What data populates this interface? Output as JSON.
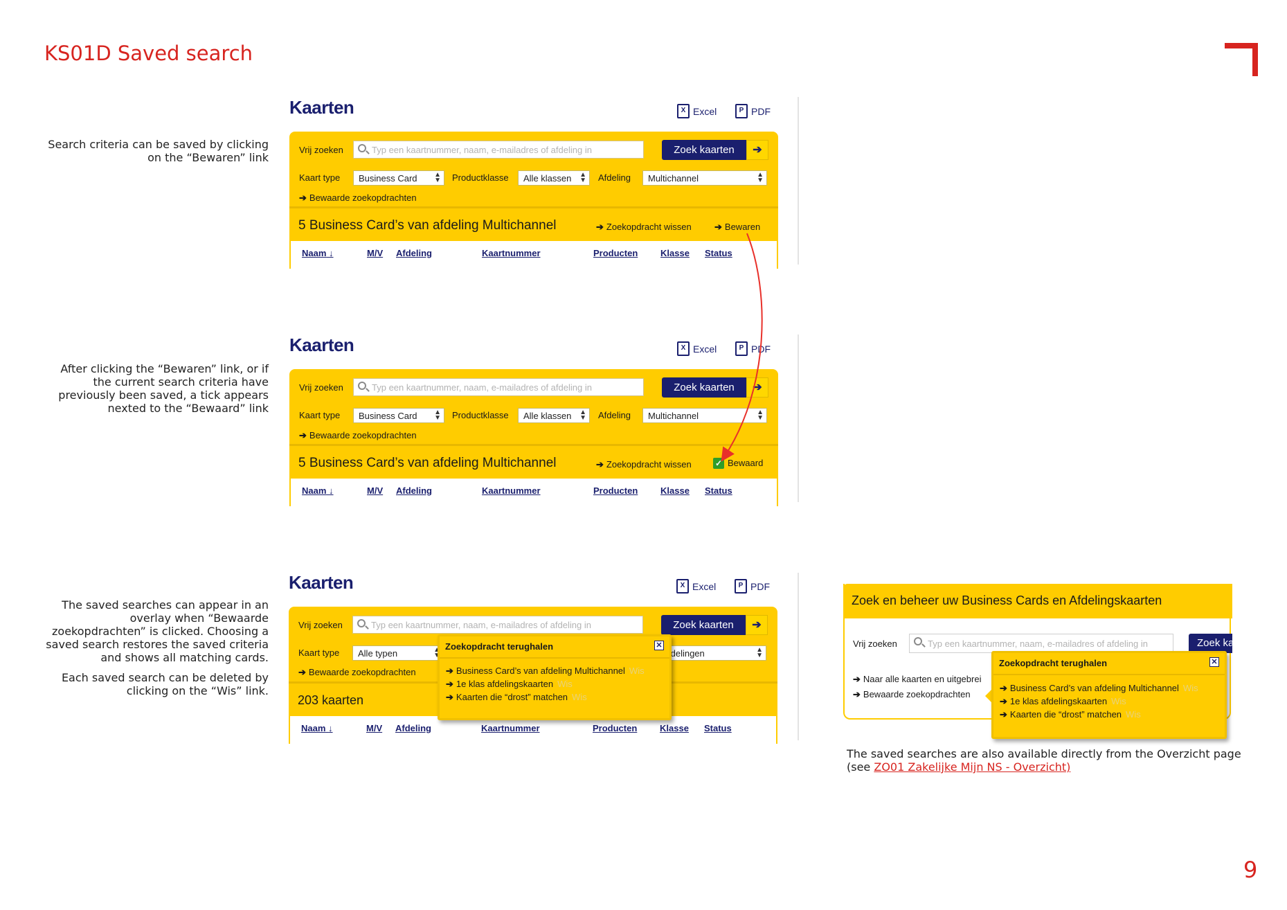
{
  "page": {
    "title": "KS01D Saved search",
    "number": "9"
  },
  "notes": {
    "n1": "Search criteria can be saved by clicking on the “Bewaren” link",
    "n2": "After clicking the “Bewaren” link, or if the current search criteria have previously been saved, a tick appears nexted to the “Bewaard” link",
    "n3a": "The saved searches can appear in an overlay when “Bewaarde zoekopdrachten” is clicked. Choosing a saved search restores the saved criteria and shows all matching cards.",
    "n3b": "Each saved search can be deleted by clicking on the “Wis” link."
  },
  "common": {
    "title": "Kaarten",
    "excel": "Excel",
    "pdf": "PDF",
    "vrij_zoeken": "Vrij zoeken",
    "search_placeholder": "Typ een kaartnummer, naam, e-mailadres of afdeling in",
    "zoek_button": "Zoek kaarten",
    "arrow": "➔",
    "kaart_type": "Kaart type",
    "productklasse": "Productklasse",
    "afdeling": "Afdeling",
    "bewaarde": "Bewaarde zoekopdrachten",
    "wissen": "Zoekopdracht wissen",
    "columns": {
      "naam": "Naam",
      "mv": "M/V",
      "afdeling": "Afdeling",
      "kaartnummer": "Kaartnummer",
      "producten": "Producten",
      "klasse": "Klasse",
      "status": "Status"
    },
    "sort_arrow": "↓"
  },
  "panel1": {
    "kaart_type_value": "Business Card",
    "productklasse_value": "Alle klassen",
    "afdeling_value": "Multichannel",
    "result": "5 Business Card’s van afdeling Multichannel",
    "save_link": "Bewaren"
  },
  "panel2": {
    "kaart_type_value": "Business Card",
    "productklasse_value": "Alle klassen",
    "afdeling_value": "Multichannel",
    "result": "5 Business Card’s van afdeling Multichannel",
    "saved_link": "Bewaard"
  },
  "panel3": {
    "kaart_type_value": "Alle typen",
    "afdeling_value_partial": "fdelingen",
    "result": "203 kaarten"
  },
  "overlay": {
    "title": "Zoekopdracht terughalen",
    "close": "✕",
    "items": [
      "Business Card’s van afdeling Multichannel",
      "1e klas afdelingskaarten",
      "Kaarten die “drost” matchen"
    ],
    "wis": "Wis"
  },
  "overview": {
    "title": "Zoek en beheer uw Business Cards en Afdelingskaarten",
    "vrij_zoeken": "Vrij zoeken",
    "search_placeholder": "Typ een kaartnummer, naam, e-mailadres of afdeling in",
    "zoek_button_partial": "Zoek ka",
    "link1_partial": "Naar alle kaarten en uitgebrei",
    "link2": "Bewaarde zoekopdrachten",
    "caption_line1": "The saved searches are also available directly from the Overzicht page",
    "caption_prefix": "(see ",
    "caption_ref": "ZO01 Zakelijke Mijn NS - Overzicht)"
  },
  "colors": {
    "brand_red": "#d7241f",
    "ns_yellow": "#ffcc00",
    "ns_blue": "#1a1f6e",
    "tick_green": "#2e9d2a"
  }
}
